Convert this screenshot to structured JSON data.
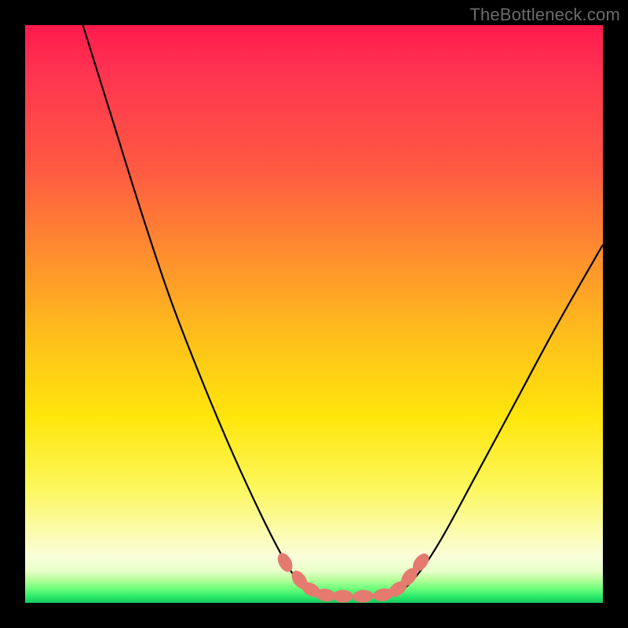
{
  "watermark": "TheBottleneck.com",
  "chart_data": {
    "type": "line",
    "title": "",
    "xlabel": "",
    "ylabel": "",
    "xlim": [
      0,
      100
    ],
    "ylim": [
      0,
      100
    ],
    "grid": false,
    "legend": false,
    "series": [
      {
        "name": "left-branch",
        "x": [
          10,
          15,
          20,
          25,
          30,
          35,
          40,
          44,
          47,
          49
        ],
        "y": [
          100,
          84,
          68,
          53,
          40,
          28,
          17,
          9,
          4,
          2
        ]
      },
      {
        "name": "valley-floor",
        "x": [
          49,
          52,
          56,
          60,
          63,
          65
        ],
        "y": [
          2,
          1.3,
          1.1,
          1.2,
          1.5,
          2
        ]
      },
      {
        "name": "right-branch",
        "x": [
          65,
          68,
          72,
          78,
          85,
          92,
          100
        ],
        "y": [
          2,
          5,
          11,
          22,
          35,
          48,
          62
        ]
      }
    ],
    "markers": [
      {
        "name": "left-bead-1",
        "x": 45.0,
        "y": 7.0
      },
      {
        "name": "left-bead-2",
        "x": 47.5,
        "y": 4.0
      },
      {
        "name": "left-bead-3",
        "x": 49.5,
        "y": 2.3
      },
      {
        "name": "floor-bead-1",
        "x": 52.0,
        "y": 1.35
      },
      {
        "name": "floor-bead-2",
        "x": 55.0,
        "y": 1.15
      },
      {
        "name": "floor-bead-3",
        "x": 58.5,
        "y": 1.15
      },
      {
        "name": "floor-bead-4",
        "x": 62.0,
        "y": 1.4
      },
      {
        "name": "right-bead-1",
        "x": 64.5,
        "y": 2.4
      },
      {
        "name": "right-bead-2",
        "x": 66.5,
        "y": 4.5
      },
      {
        "name": "right-bead-3",
        "x": 68.5,
        "y": 7.0
      }
    ],
    "colors": {
      "bead": "#e57a6f",
      "curve": "#000000",
      "gradient_top": "#ff1a4d",
      "gradient_bottom": "#17c95e"
    }
  }
}
